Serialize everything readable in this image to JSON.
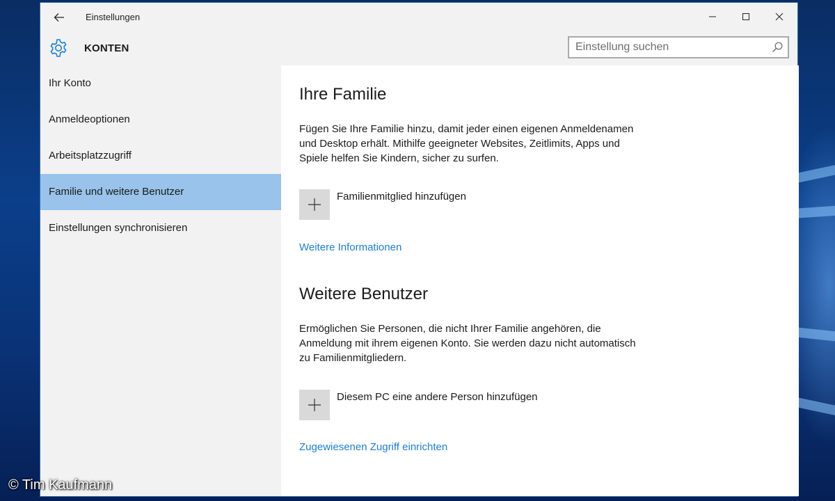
{
  "window": {
    "title": "Einstellungen"
  },
  "header": {
    "section_title": "KONTEN",
    "search_placeholder": "Einstellung suchen"
  },
  "sidebar": {
    "items": [
      {
        "label": "Ihr Konto",
        "active": false
      },
      {
        "label": "Anmeldeoptionen",
        "active": false
      },
      {
        "label": "Arbeitsplatzzugriff",
        "active": false
      },
      {
        "label": "Familie und weitere Benutzer",
        "active": true
      },
      {
        "label": "Einstellungen synchronisieren",
        "active": false
      }
    ]
  },
  "main": {
    "family": {
      "heading": "Ihre Familie",
      "description": "Fügen Sie Ihre Familie hinzu, damit jeder einen eigenen Anmeldenamen und Desktop erhält. Mithilfe geeigneter Websites, Zeitlimits, Apps und Spiele helfen Sie Kindern, sicher zu surfen.",
      "add_label": "Familienmitglied hinzufügen",
      "link": "Weitere Informationen"
    },
    "others": {
      "heading": "Weitere Benutzer",
      "description": "Ermöglichen Sie Personen, die nicht Ihrer Familie angehören, die Anmeldung mit ihrem eigenen Konto. Sie werden dazu nicht automatisch zu Familienmitgliedern.",
      "add_label": "Diesem PC eine andere Person hinzufügen",
      "link": "Zugewiesenen Zugriff einrichten"
    }
  },
  "watermark": "© Tim Kaufmann",
  "colors": {
    "accent": "#1a7fd6",
    "selected_nav": "#99c3ea",
    "sidebar_bg": "#f2f2f2",
    "desktop": "#0b3f8a"
  },
  "icons": [
    "back-arrow-icon",
    "minimize-icon",
    "maximize-icon",
    "close-icon",
    "gear-icon",
    "search-icon",
    "plus-icon"
  ]
}
